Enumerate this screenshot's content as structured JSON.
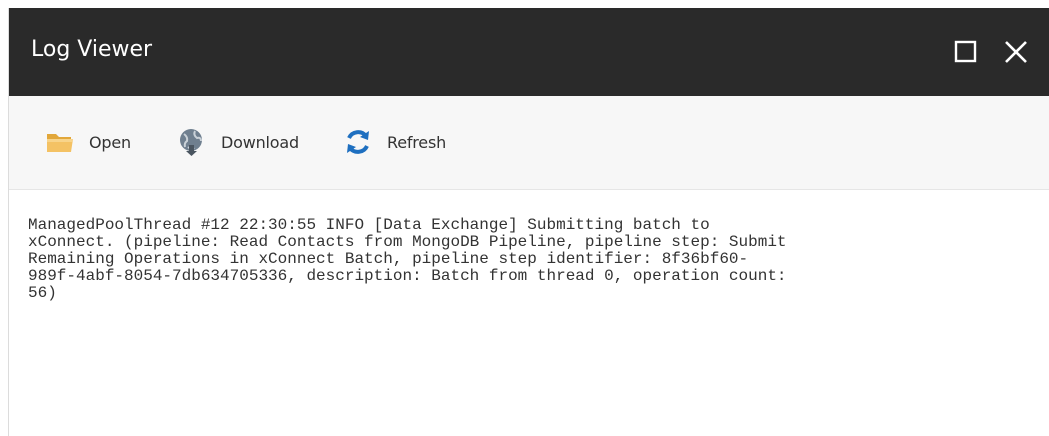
{
  "window": {
    "title": "Log Viewer",
    "maximize_icon": "maximize-icon",
    "close_icon": "close-icon",
    "titlebar_color": "#2a2a2a"
  },
  "toolbar": {
    "open": {
      "label": "Open",
      "icon": "folder-icon"
    },
    "download": {
      "label": "Download",
      "icon": "globe-download-icon"
    },
    "refresh": {
      "label": "Refresh",
      "icon": "refresh-icon"
    }
  },
  "log": {
    "lines": [
      "ManagedPoolThread #12 22:30:55 INFO [Data Exchange] Submitting batch to",
      "xConnect. (pipeline: Read Contacts from MongoDB Pipeline, pipeline step: Submit",
      "Remaining Operations in xConnect Batch, pipeline step identifier: 8f36bf60-",
      "989f-4abf-8054-7db634705336, description: Batch from thread 0, operation count:",
      "56)"
    ]
  }
}
